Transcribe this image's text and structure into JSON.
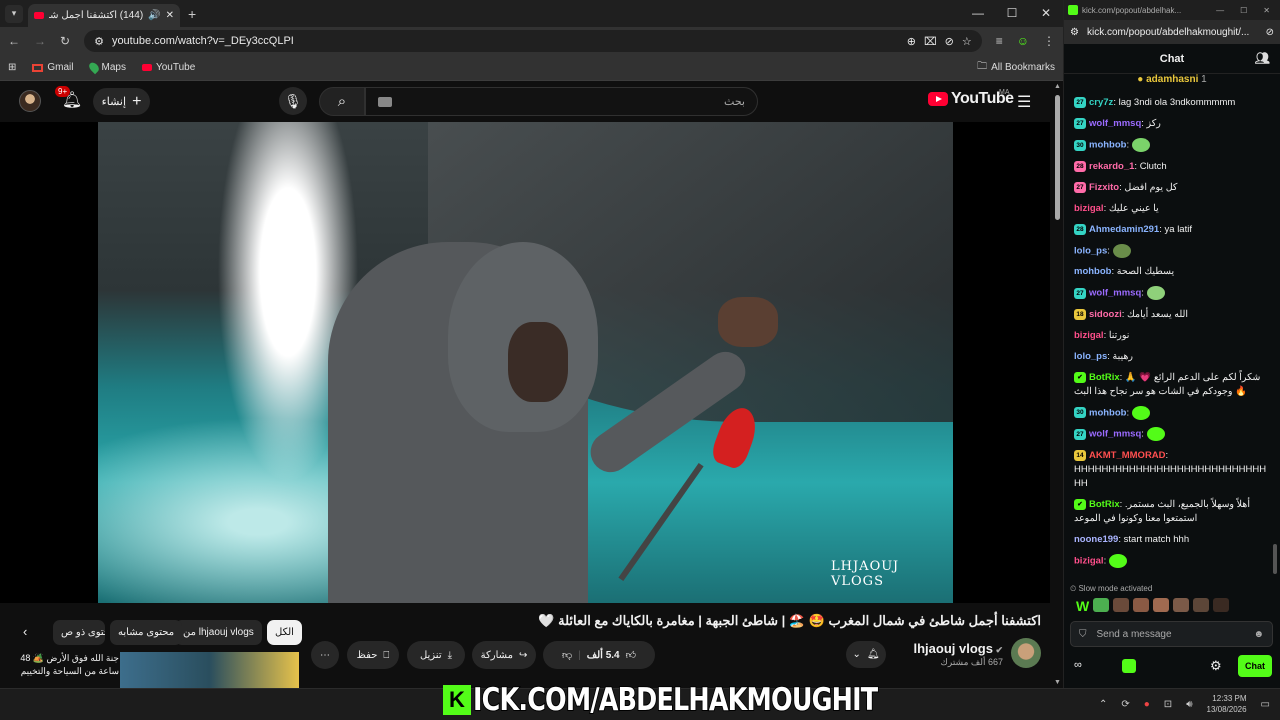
{
  "browser": {
    "tab_title": "(144) اكتشفنا أجمل شاطئ ف...",
    "url": "youtube.com/watch?v=_DEy3ccQLPI",
    "bookmarks": [
      "Gmail",
      "Maps",
      "YouTube"
    ],
    "all_bookmarks": "All Bookmarks"
  },
  "youtube": {
    "notif_count": "9+",
    "create_label": "إنشاء",
    "search_placeholder": "بحث",
    "logo": "YouTube",
    "country": "MA",
    "video_watermark": "LHJAOUJ VLOGS",
    "title": "اكتشفنا أجمل شاطئ في شمال المغرب 🤩 🏖️ | شاطئ الجبهة | مغامرة بالكاياك مع العائلة 🤍",
    "channel_name": "lhjaouj vlogs",
    "subscribers": "667 ألف مشترك",
    "likes": "5.4 ألف",
    "share": "مشاركة",
    "download": "تنزيل",
    "save": "حفظ",
    "chips": [
      "الكل",
      "من lhjaouj vlogs",
      "محتوى مشابه",
      "محتوى ذو ص"
    ],
    "rec_title": "جنة الله فوق الأرض 🏕️ 48 ساعة من السياحة والتخييم"
  },
  "kick": {
    "window_url": "kick.com/popout/abdelhak...",
    "url": "kick.com/popout/abdelhakmoughit/...",
    "chat_label": "Chat",
    "pinned_user": "adamhasni",
    "pinned_count": "1",
    "messages": [
      {
        "badge": "27",
        "badge_color": "#34d4c4",
        "user": "cry7z",
        "user_color": "#34d4c4",
        "text": "lag 3ndi ola 3ndkommmmm"
      },
      {
        "badge": "27",
        "badge_color": "#34d4c4",
        "user": "wolf_mmsq",
        "user_color": "#9b6bff",
        "text": "ركز"
      },
      {
        "badge": "30",
        "badge_color": "#34d4c4",
        "user": "mohbob",
        "user_color": "#8ab4ff",
        "text": "",
        "emote": "#7bd36a"
      },
      {
        "badge": "28",
        "badge_color": "#ff6ba8",
        "user": "rekardo_1",
        "user_color": "#ff6ba8",
        "text": "Clutch"
      },
      {
        "badge": "27",
        "badge_color": "#ff6ba8",
        "user": "Fizxito",
        "user_color": "#ff6ba8",
        "text": "كل يوم افضل"
      },
      {
        "badge": "",
        "badge_color": "",
        "user": "bizigal",
        "user_color": "#ff4f8b",
        "text": "يا عيني عليك"
      },
      {
        "badge": "28",
        "badge_color": "#34d4c4",
        "user": "Ahmedamin291",
        "user_color": "#8ab4ff",
        "text": "ya latif"
      },
      {
        "badge": "",
        "badge_color": "",
        "user": "lolo_ps",
        "user_color": "#8ab4ff",
        "text": "",
        "emote": "#6a8d4a"
      },
      {
        "badge": "",
        "badge_color": "",
        "user": "mohbob",
        "user_color": "#8ab4ff",
        "text": "يسطيك الصحة"
      },
      {
        "badge": "27",
        "badge_color": "#34d4c4",
        "user": "wolf_mmsq",
        "user_color": "#9b6bff",
        "text": "",
        "emote": "#8fd07a"
      },
      {
        "badge": "18",
        "badge_color": "#e9c73c",
        "user": "sidoozi",
        "user_color": "#ff6ba8",
        "text": "الله يسعد أيامك"
      },
      {
        "badge": "",
        "badge_color": "",
        "user": "bizigal",
        "user_color": "#ff4f8b",
        "text": "نورتنا"
      },
      {
        "badge": "",
        "badge_color": "",
        "user": "lolo_ps",
        "user_color": "#8ab4ff",
        "text": "رهيبة"
      },
      {
        "badge": "✔",
        "badge_color": "#53fc18",
        "user": "BotRix",
        "user_color": "#53fc18",
        "text": "🙏 شكراً لكم على الدعم الرائع 💗 وجودكم في الشات هو سر نجاح هذا البث 🔥"
      },
      {
        "badge": "30",
        "badge_color": "#34d4c4",
        "user": "mohbob",
        "user_color": "#8ab4ff",
        "text": "",
        "emote": "#53fc18"
      },
      {
        "badge": "27",
        "badge_color": "#34d4c4",
        "user": "wolf_mmsq",
        "user_color": "#9b6bff",
        "text": "",
        "emote": "#53fc18"
      },
      {
        "badge": "14",
        "badge_color": "#e9c73c",
        "user": "AKMT_MMORAD",
        "user_color": "#ff4f4f",
        "text": "HHHHHHHHHHHHHHHHHHHHHHHHHHHHHH"
      },
      {
        "badge": "✔",
        "badge_color": "#53fc18",
        "user": "BotRix",
        "user_color": "#53fc18",
        "text": "أهلاً وسهلاً بالجميع، البث مستمر. استمتعوا معنا وكونوا في الموعد"
      },
      {
        "badge": "",
        "badge_color": "",
        "user": "noone199",
        "user_color": "#aab4ff",
        "text": "start match hhh"
      },
      {
        "badge": "",
        "badge_color": "",
        "user": "bizigal",
        "user_color": "#ff4f8b",
        "text": "",
        "emote": "#53fc18"
      }
    ],
    "slow_mode": "Slow mode activated",
    "send_placeholder": "Send a message",
    "chat_button": "Chat"
  },
  "overlay": {
    "text": "ICK.COM/ABDELHAKMOUGHIT",
    "logo_letter": "K"
  },
  "taskbar": {
    "time": "12:33 PM",
    "date": "13/08/2026"
  }
}
